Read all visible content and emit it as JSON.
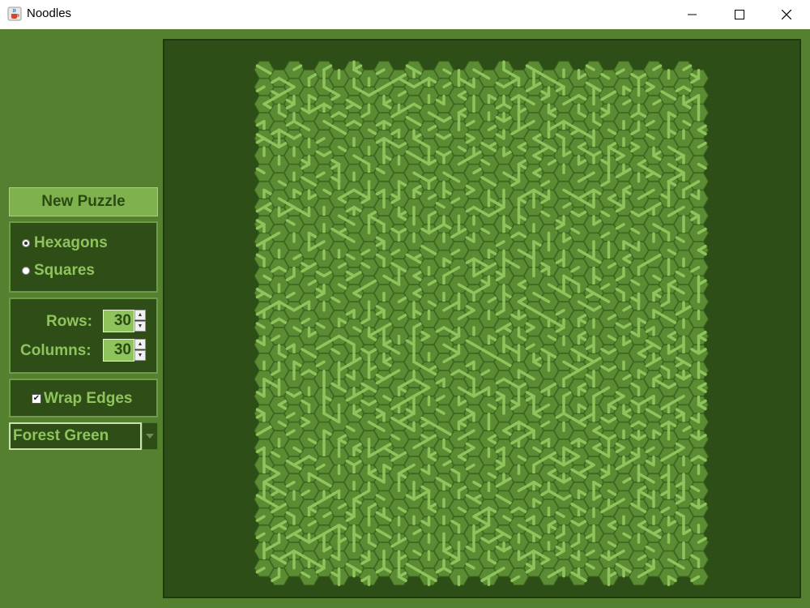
{
  "window": {
    "title": "Noodles",
    "icon": "java-cup-icon",
    "controls": [
      "minimize-icon",
      "maximize-icon",
      "close-icon"
    ]
  },
  "sidebar": {
    "new_puzzle": "New Puzzle",
    "shape": {
      "options": [
        "Hexagons",
        "Squares"
      ],
      "selected": "Hexagons"
    },
    "size": {
      "rows_label": "Rows:",
      "rows_value": "30",
      "columns_label": "Columns:",
      "columns_value": "30"
    },
    "wrap_edges": {
      "label": "Wrap Edges",
      "checked": true
    },
    "theme": {
      "selected": "Forest Green"
    }
  },
  "board": {
    "tile_shape": "hexagon",
    "rows": 30,
    "columns": 30
  },
  "colors": {
    "background": "#548030",
    "panel": "#2f4e17",
    "tile": "#5b8c33",
    "pipe": "#8fc45d",
    "accent": "#7fb24f"
  }
}
